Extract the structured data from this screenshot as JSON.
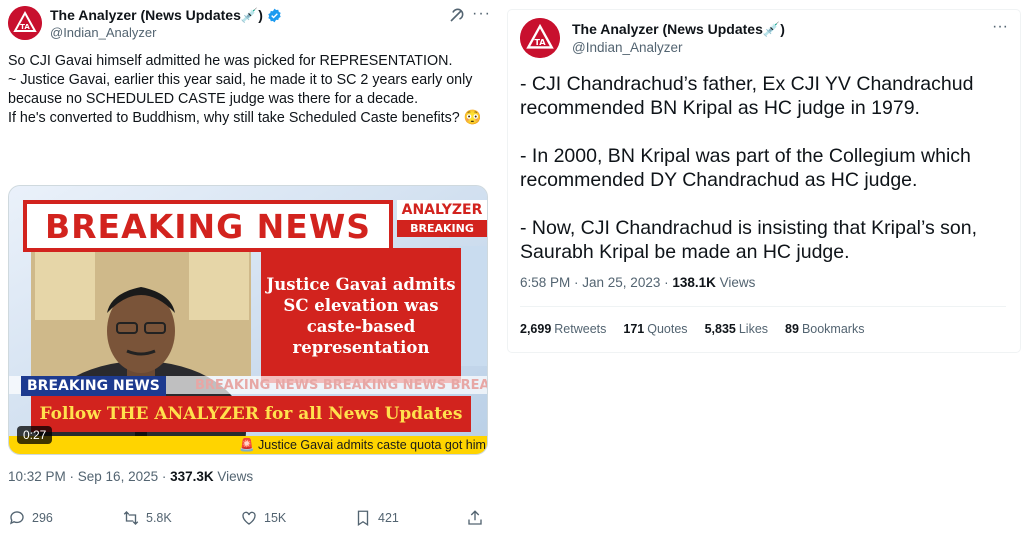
{
  "left_tweet": {
    "author_name": "The Analyzer (News Updates💉)",
    "handle": "@Indian_Analyzer",
    "more_label": "···",
    "text_lines": [
      "So CJI Gavai himself admitted he was picked for REPRESENTATION.",
      "~ Justice Gavai, earlier this year said, he made it to SC 2 years early only because no SCHEDULED CASTE judge was there for a decade.",
      "",
      "If he's converted to Buddhism, why still take Scheduled Caste benefits? 😳"
    ],
    "media": {
      "breaking_news": "BREAKING NEWS",
      "logo_top": "ANALYZER",
      "logo_bottom": "BREAKING",
      "headline": "Justice Gavai admits SC elevation was caste-based representation",
      "breaking_small": "BREAKING NEWS",
      "ghost_text": "BREAKING NEWS  BREAKING NEWS  BREAK",
      "follow_text": "Follow THE ANALYZER for all News Updates",
      "ticker": "🚨 Justice Gavai admits caste quota got him SC",
      "duration": "0:27"
    },
    "timestamp": "10:32 PM · Sep 16, 2025 · ",
    "views_count": "337.3K",
    "views_label": " Views",
    "actions": {
      "replies": "296",
      "reposts": "5.8K",
      "likes": "15K",
      "bookmarks": "421"
    }
  },
  "right_tweet": {
    "author_name": "The Analyzer (News Updates💉)",
    "handle": "@Indian_Analyzer",
    "more_label": "···",
    "paragraphs": [
      "- CJI Chandrachud’s father, Ex CJI YV Chandrachud recommended  BN Kripal as HC judge in 1979.",
      "- In 2000, BN Kripal was part of the Collegium which recommended DY Chandrachud as HC judge.",
      "- Now, CJI Chandrachud is insisting that Kripal’s son, Saurabh Kripal be made an HC judge."
    ],
    "timestamp": "6:58 PM · Jan 25, 2023 · ",
    "views_count": "138.1K",
    "views_label": " Views",
    "stats": {
      "retweets_count": "2,699",
      "retweets_label": "Retweets",
      "quotes_count": "171",
      "quotes_label": "Quotes",
      "likes_count": "5,835",
      "likes_label": "Likes",
      "bookmarks_count": "89",
      "bookmarks_label": "Bookmarks"
    }
  },
  "colors": {
    "brand_red": "#d2231e",
    "verified_blue": "#1d9bf0",
    "muted_text": "#536471"
  }
}
